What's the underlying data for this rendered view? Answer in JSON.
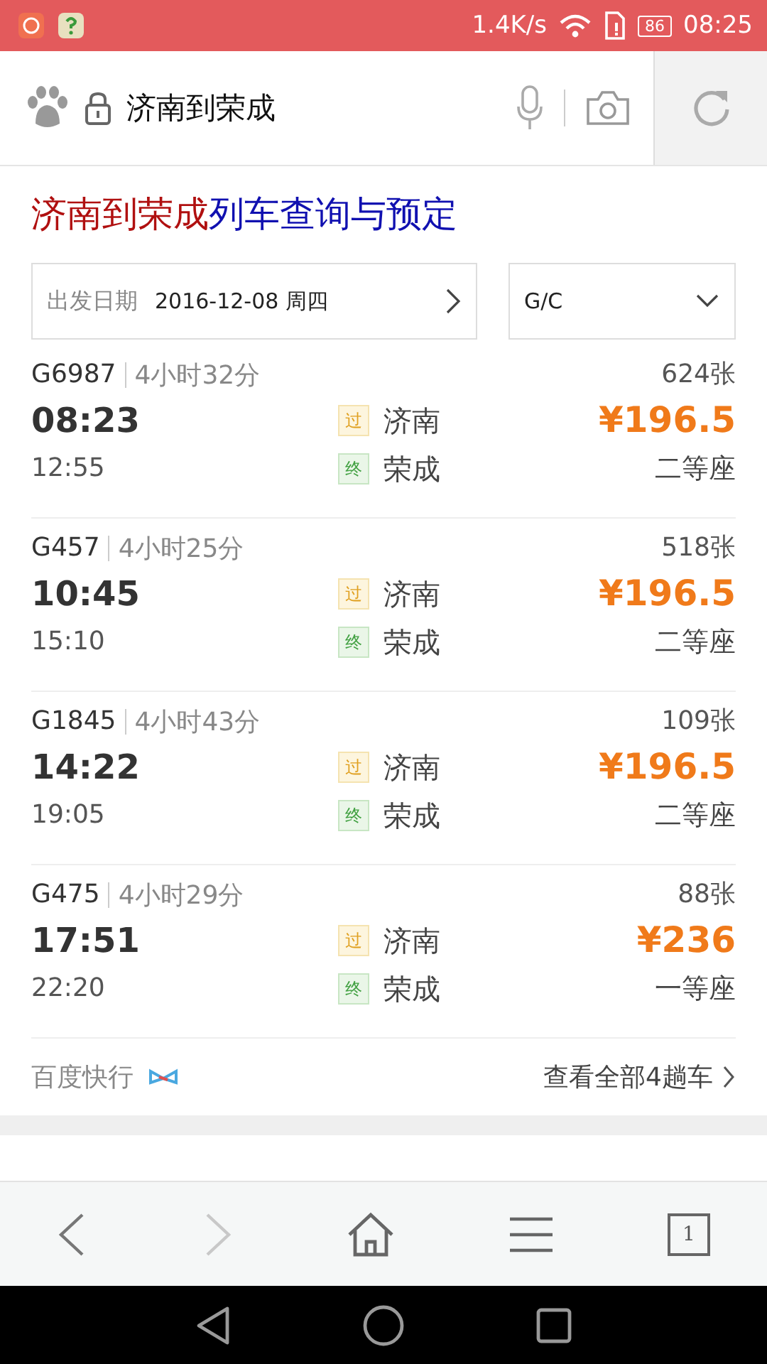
{
  "status_bar": {
    "speed": "1.4K/s",
    "battery": "86",
    "time": "08:25"
  },
  "address_bar": {
    "query": "济南到荣成"
  },
  "title_parts": [
    {
      "text": "济南到荣成",
      "color": "#b01010"
    },
    {
      "text": "列车查询与预定",
      "color": "#1010b0"
    }
  ],
  "date_selector": {
    "label": "出发日期",
    "value": "2016-12-08 周四"
  },
  "type_selector": {
    "value": "G/C"
  },
  "trains": [
    {
      "number": "G6987",
      "duration": "4小时32分",
      "depart": "08:23",
      "arrive": "12:55",
      "stops": [
        {
          "kind": "pass",
          "badge": "过",
          "name": "济南"
        },
        {
          "kind": "end",
          "badge": "终",
          "name": "荣成"
        }
      ],
      "tickets": "624张",
      "price": "¥196.5",
      "seat": "二等座"
    },
    {
      "number": "G457",
      "duration": "4小时25分",
      "depart": "10:45",
      "arrive": "15:10",
      "stops": [
        {
          "kind": "pass",
          "badge": "过",
          "name": "济南"
        },
        {
          "kind": "end",
          "badge": "终",
          "name": "荣成"
        }
      ],
      "tickets": "518张",
      "price": "¥196.5",
      "seat": "二等座"
    },
    {
      "number": "G1845",
      "duration": "4小时43分",
      "depart": "14:22",
      "arrive": "19:05",
      "stops": [
        {
          "kind": "pass",
          "badge": "过",
          "name": "济南"
        },
        {
          "kind": "end",
          "badge": "终",
          "name": "荣成"
        }
      ],
      "tickets": "109张",
      "price": "¥196.5",
      "seat": "二等座"
    },
    {
      "number": "G475",
      "duration": "4小时29分",
      "depart": "17:51",
      "arrive": "22:20",
      "stops": [
        {
          "kind": "pass",
          "badge": "过",
          "name": "济南"
        },
        {
          "kind": "end",
          "badge": "终",
          "name": "荣成"
        }
      ],
      "tickets": "88张",
      "price": "¥236",
      "seat": "一等座"
    }
  ],
  "footer": {
    "brand": "百度快行",
    "more_link": "查看全部4趟车"
  },
  "toolbar": {
    "back_disabled": false,
    "forward_disabled": true,
    "tabs_count": "1"
  }
}
